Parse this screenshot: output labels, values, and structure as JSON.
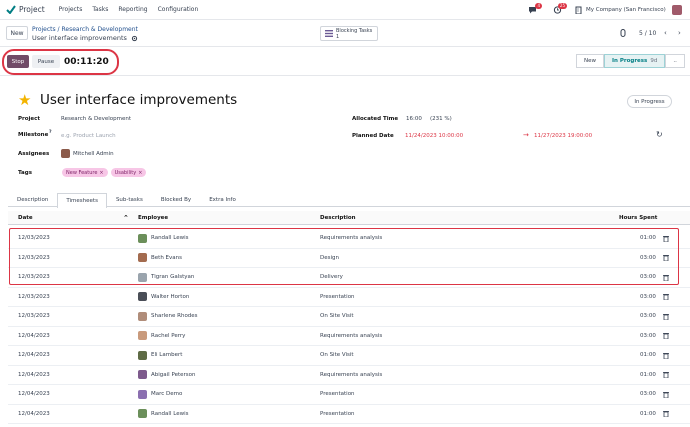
{
  "nav": {
    "app_name": "Project",
    "menu": [
      "Projects",
      "Tasks",
      "Reporting",
      "Configuration"
    ],
    "chat_count": "4",
    "activity_count": "25",
    "company": "My Company (San Francisco)"
  },
  "control": {
    "new_label": "New",
    "breadcrumb_parent": "Projects / Research & Development",
    "breadcrumb_current": "User interface improvements",
    "blocking_label": "Blocking Tasks",
    "blocking_count": "1",
    "pager": "5 / 10"
  },
  "timer": {
    "stop_label": "Stop",
    "pause_label": "Pause",
    "value": "00:11:20"
  },
  "stages": {
    "new": "New",
    "in_progress": "In Progress",
    "in_progress_days": "9d",
    "more": ".."
  },
  "task": {
    "title": "User interface improvements",
    "status": "In Progress",
    "project_label": "Project",
    "project_value": "Research & Development",
    "milestone_label": "Milestone",
    "milestone_value": "e.g. Product Launch",
    "assignees_label": "Assignees",
    "assignee": "Mitchell Admin",
    "tags_label": "Tags",
    "tags": [
      "New Feature",
      "Usability"
    ],
    "allocated_label": "Allocated Time",
    "allocated_value": "16:00",
    "allocated_pct": "(231 %)",
    "planned_label": "Planned Date",
    "planned_start": "11/24/2023 10:00:00",
    "planned_end": "11/27/2023 19:00:00"
  },
  "tabs": [
    "Description",
    "Timesheets",
    "Sub-tasks",
    "Blocked By",
    "Extra Info"
  ],
  "table": {
    "headers": {
      "date": "Date",
      "employee": "Employee",
      "description": "Description",
      "hours": "Hours Spent"
    },
    "rows": [
      {
        "date": "12/03/2023",
        "employee": "Randall Lewis",
        "description": "Requirements analysis",
        "hours": "01:00",
        "color": "#6b8f5a"
      },
      {
        "date": "12/03/2023",
        "employee": "Beth Evans",
        "description": "Design",
        "hours": "03:00",
        "color": "#a36b4f"
      },
      {
        "date": "12/03/2023",
        "employee": "Tigran Galstyan",
        "description": "Delivery",
        "hours": "03:00",
        "color": "#9aa4ad"
      },
      {
        "date": "12/03/2023",
        "employee": "Walter Horton",
        "description": "Presentation",
        "hours": "03:00",
        "color": "#4a4e57"
      },
      {
        "date": "12/03/2023",
        "employee": "Sharlene Rhodes",
        "description": "On Site Visit",
        "hours": "03:00",
        "color": "#b08d7a"
      },
      {
        "date": "12/04/2023",
        "employee": "Rachel Perry",
        "description": "Requirements analysis",
        "hours": "03:00",
        "color": "#c99a7c"
      },
      {
        "date": "12/04/2023",
        "employee": "Eli Lambert",
        "description": "On Site Visit",
        "hours": "01:00",
        "color": "#5e6b45"
      },
      {
        "date": "12/04/2023",
        "employee": "Abigail Peterson",
        "description": "Requirements analysis",
        "hours": "01:00",
        "color": "#7d5a8c"
      },
      {
        "date": "12/04/2023",
        "employee": "Marc Demo",
        "description": "Presentation",
        "hours": "03:00",
        "color": "#8b6fb0"
      },
      {
        "date": "12/04/2023",
        "employee": "Randall Lewis",
        "description": "Presentation",
        "hours": "01:00",
        "color": "#6b8f5a"
      }
    ]
  },
  "colors": {
    "accent": "#714B67",
    "teal": "#017e84",
    "link": "#1f4e8c",
    "highlight": "#dc3545",
    "star": "#f3b400"
  }
}
